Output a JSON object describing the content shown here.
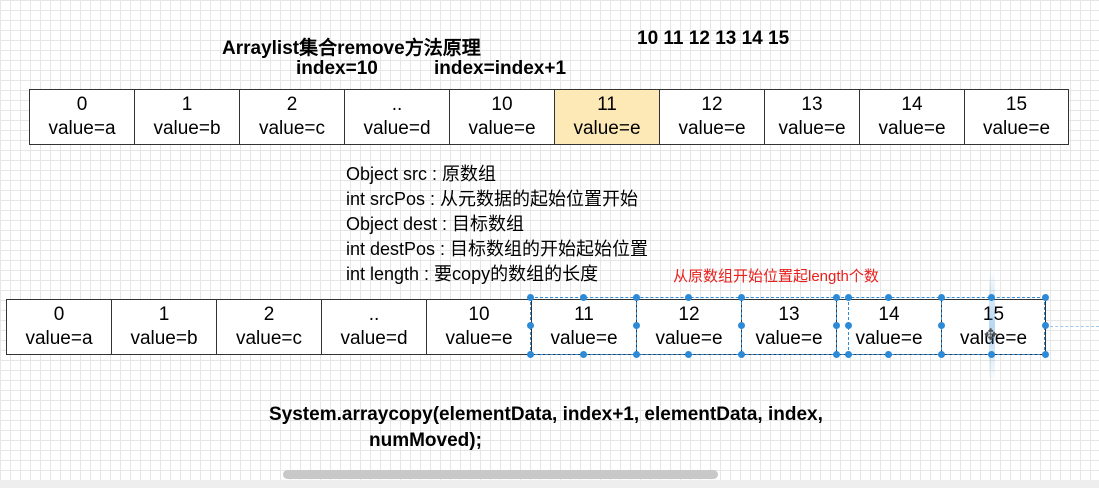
{
  "header": {
    "title": "Arraylist集合remove方法原理",
    "index_label": "index=10",
    "index_next_label": "index=index+1",
    "sequence": "10 11 12 13 14 15"
  },
  "top_array": [
    {
      "index": "0",
      "value": "value=a"
    },
    {
      "index": "1",
      "value": "value=b"
    },
    {
      "index": "2",
      "value": "value=c"
    },
    {
      "index": "..",
      "value": "value=d"
    },
    {
      "index": "10",
      "value": "value=e"
    },
    {
      "index": "11",
      "value": "value=e"
    },
    {
      "index": "12",
      "value": "value=e"
    },
    {
      "index": "13",
      "value": "value=e"
    },
    {
      "index": "14",
      "value": "value=e"
    },
    {
      "index": "15",
      "value": "value=e"
    }
  ],
  "params": [
    "Object src : 原数组",
    "int srcPos : 从元数据的起始位置开始",
    "Object dest : 目标数组",
    "int destPos : 目标数组的开始起始位置",
    "int length  : 要copy的数组的长度"
  ],
  "note": "从原数组开始位置起length个数",
  "bottom_array": [
    {
      "index": "0",
      "value": "value=a"
    },
    {
      "index": "1",
      "value": "value=b"
    },
    {
      "index": "2",
      "value": "value=c"
    },
    {
      "index": "..",
      "value": "value=d"
    },
    {
      "index": "10",
      "value": "value=e"
    },
    {
      "index": "11",
      "value": "value=e"
    },
    {
      "index": "12",
      "value": "value=e"
    },
    {
      "index": "13",
      "value": "value=e"
    },
    {
      "index": "14",
      "value": "value=e"
    },
    {
      "index": "15",
      "value": "value=e"
    }
  ],
  "code": {
    "line1": "System.arraycopy(elementData, index+1, elementData, index,",
    "line2": "numMoved);"
  },
  "colors": {
    "highlight": "#fde9b6",
    "selection": "#2d8ad6",
    "note": "#e8201c"
  }
}
